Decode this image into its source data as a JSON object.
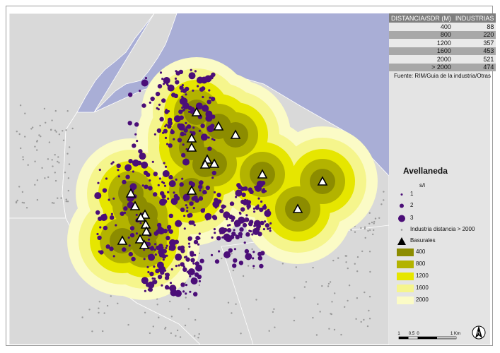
{
  "table": {
    "headers": [
      "DISTANCIA/SDR (M)",
      "INDUSTRIAS"
    ],
    "rows": [
      {
        "distance": "400",
        "count": "88"
      },
      {
        "distance": "800",
        "count": "220"
      },
      {
        "distance": "1200",
        "count": "357"
      },
      {
        "distance": "1600",
        "count": "453"
      },
      {
        "distance": "2000",
        "count": "521"
      },
      {
        "distance": "> 2000",
        "count": "474"
      }
    ]
  },
  "source": "Fuente: RIM/Guia de la industria/Otras",
  "legend": {
    "title": "Avellaneda",
    "subtitle": "s/i",
    "point_sizes": [
      "1",
      "2",
      "3"
    ],
    "industry_far_label": "Industria distancia > 2000",
    "basurales_label": "Basurales",
    "buffers": [
      {
        "label": "400",
        "color": "#8c8c00"
      },
      {
        "label": "800",
        "color": "#b3b300"
      },
      {
        "label": "1200",
        "color": "#e6e600"
      },
      {
        "label": "1600",
        "color": "#f5f58c"
      },
      {
        "label": "2000",
        "color": "#fbfbc6"
      }
    ]
  },
  "colors": {
    "river": "#a9aed6",
    "land": "#d9d9d9",
    "industry": "#4b0e78",
    "far_industry": "#9a9a9a",
    "basural_fill": "#ffffff"
  },
  "scale_bar": {
    "labels": [
      "1",
      "0.5",
      "0",
      "1 Km"
    ]
  },
  "north_arrow": {
    "label": "N"
  },
  "icons": [
    "triangle-icon",
    "circle-icon",
    "north-arrow-icon"
  ]
}
